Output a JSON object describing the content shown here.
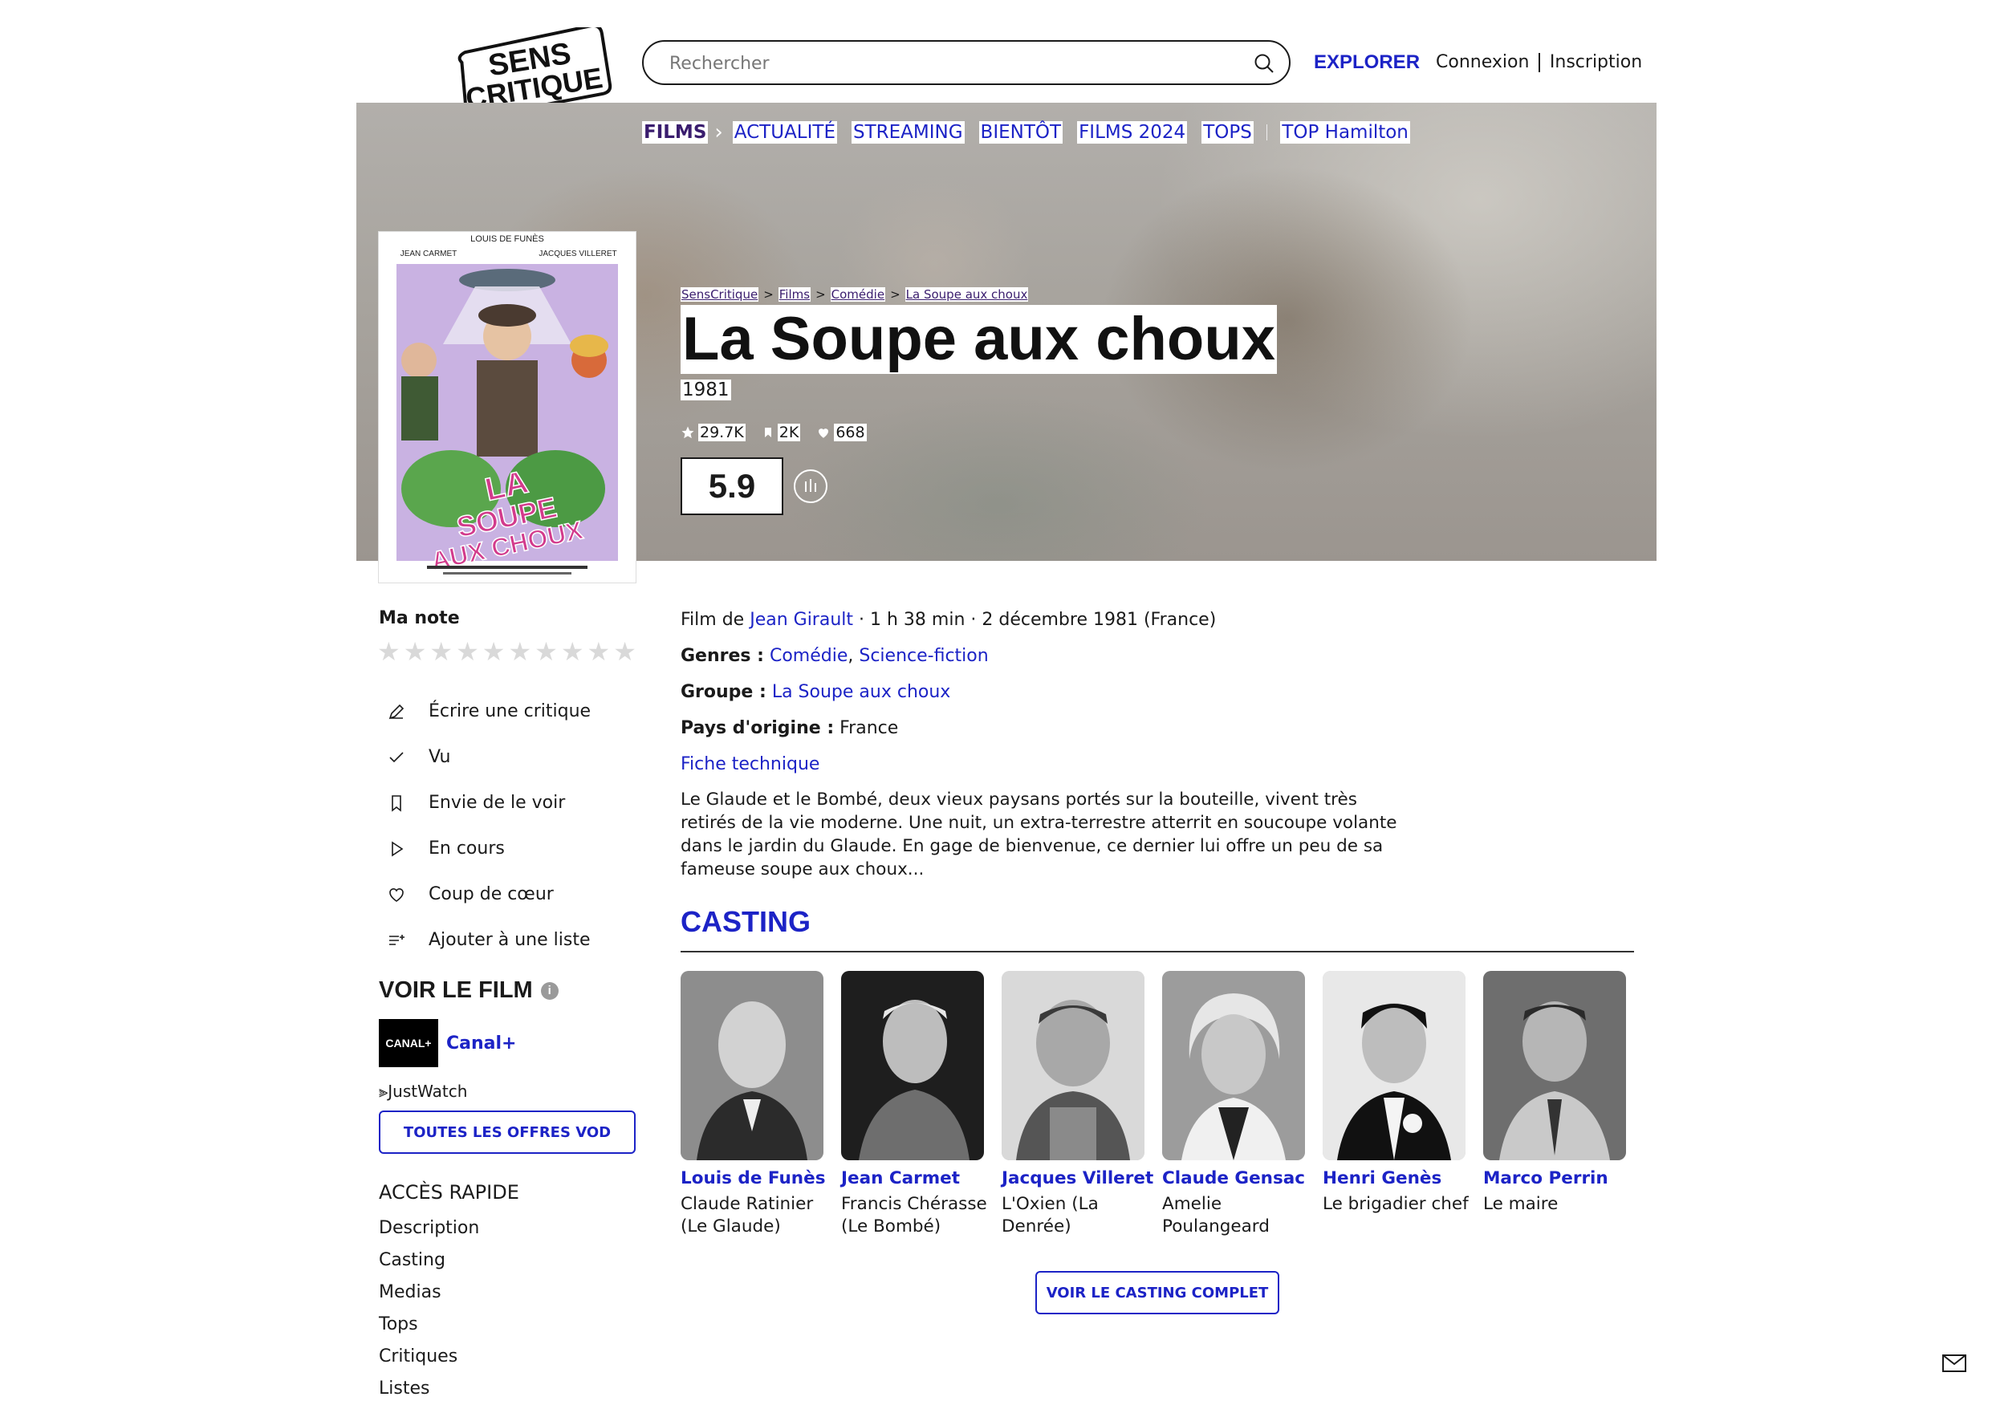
{
  "header": {
    "logo_lines": [
      "SENS",
      "CRITIQUE"
    ],
    "search_placeholder": "Rechercher",
    "explore": "EXPLORER",
    "login": "Connexion",
    "signup": "Inscription"
  },
  "subnav": {
    "first": "FILMS",
    "items": [
      "ACTUALITÉ",
      "STREAMING",
      "BIENTÔT",
      "FILMS 2024",
      "TOPS"
    ],
    "extra": "TOP Hamilton"
  },
  "breadcrumb": [
    "SensCritique",
    "Films",
    "Comédie",
    "La Soupe aux choux"
  ],
  "movie": {
    "title": "La Soupe aux choux",
    "year": "1981",
    "stats": {
      "ratings": "29.7K",
      "wishlist": "2K",
      "likes": "668"
    },
    "score": "5.9"
  },
  "poster": {
    "top_name": "LOUIS DE FUNÈS",
    "left_name": "JEAN CARMET",
    "right_name": "JACQUES VILLERET",
    "title_lines": [
      "LA",
      "SOUPE",
      "AUX CHOUX"
    ]
  },
  "sidebar": {
    "ma_note": "Ma note",
    "star_count": 10,
    "actions": [
      {
        "label": "Écrire une critique",
        "icon": "pencil-icon"
      },
      {
        "label": "Vu",
        "icon": "check-icon"
      },
      {
        "label": "Envie de le voir",
        "icon": "bookmark-icon"
      },
      {
        "label": "En cours",
        "icon": "play-icon"
      },
      {
        "label": "Coup de cœur",
        "icon": "heart-icon"
      },
      {
        "label": "Ajouter à une liste",
        "icon": "list-add-icon"
      }
    ],
    "voir_le_film": "VOIR LE FILM",
    "info_glyph": "i",
    "provider_logo": "CANAL+",
    "provider": "Canal+",
    "justwatch": "JustWatch",
    "vod_button": "TOUTES LES OFFRES VOD",
    "acces_title": "ACCÈS RAPIDE",
    "acces_items": [
      "Description",
      "Casting",
      "Medias",
      "Tops",
      "Critiques",
      "Listes"
    ]
  },
  "info": {
    "film_de_prefix": "Film de",
    "director": "Jean Girault",
    "details": "· 1 h 38 min · 2 décembre 1981 (France)",
    "genres_label": "Genres :",
    "genres": [
      "Comédie",
      "Science-fiction"
    ],
    "groupe_label": "Groupe :",
    "groupe": "La Soupe aux choux",
    "pays_label": "Pays d'origine :",
    "pays": "France",
    "fiche": "Fiche technique",
    "synopsis": "Le Glaude et le Bombé, deux vieux paysans portés sur la bouteille, vivent très retirés de la vie moderne. Une nuit, un extra-terrestre atterrit en soucoupe volante dans le jardin du Glaude. En gage de bienvenue, ce dernier lui offre un peu de sa fameuse soupe aux choux..."
  },
  "casting": {
    "title": "CASTING",
    "actors": [
      {
        "name": "Louis de Funès",
        "role": "Claude Ratinier (Le Glaude)"
      },
      {
        "name": "Jean Carmet",
        "role": "Francis Chérasse (Le Bombé)"
      },
      {
        "name": "Jacques Villeret",
        "role": "L'Oxien (La Denrée)"
      },
      {
        "name": "Claude Gensac",
        "role": "Amelie Poulangeard"
      },
      {
        "name": "Henri Genès",
        "role": "Le brigadier chef"
      },
      {
        "name": "Marco Perrin",
        "role": "Le maire"
      }
    ],
    "button": "VOIR LE CASTING COMPLET"
  },
  "colors": {
    "accent": "#1c23c6",
    "purple": "#3a1d6e",
    "text": "#1a1a1a"
  }
}
